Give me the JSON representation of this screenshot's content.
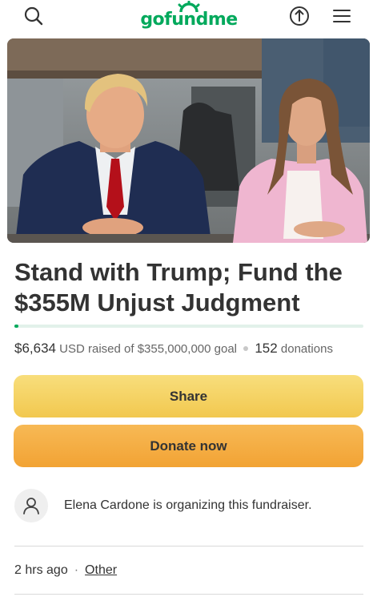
{
  "header": {
    "logo_text": "gofundme",
    "brand_color": "#02a95c",
    "search_icon": "search-icon",
    "share_icon": "share-upload-icon",
    "menu_icon": "hamburger-menu-icon"
  },
  "hero": {
    "image": "photo of a man in a dark suit with red tie seated at a courtroom table, beside a woman in a pink blazer"
  },
  "campaign": {
    "title": "Stand with Trump; Fund the $355M Unjust Judgment",
    "raised": "$6,634",
    "currency_text": "USD raised of $355,000,000 goal",
    "donations_count": "152",
    "donations_label": "donations",
    "progress_fraction": 1.87e-05
  },
  "actions": {
    "share_label": "Share",
    "donate_label": "Donate now",
    "share_color": "#f5d465",
    "donate_color": "#f4ad40"
  },
  "organizer": {
    "avatar_icon": "user-icon",
    "text": "Elena Cardone is organizing this fundraiser."
  },
  "meta": {
    "time": "2 hrs ago",
    "separator": "·",
    "category": "Other"
  }
}
